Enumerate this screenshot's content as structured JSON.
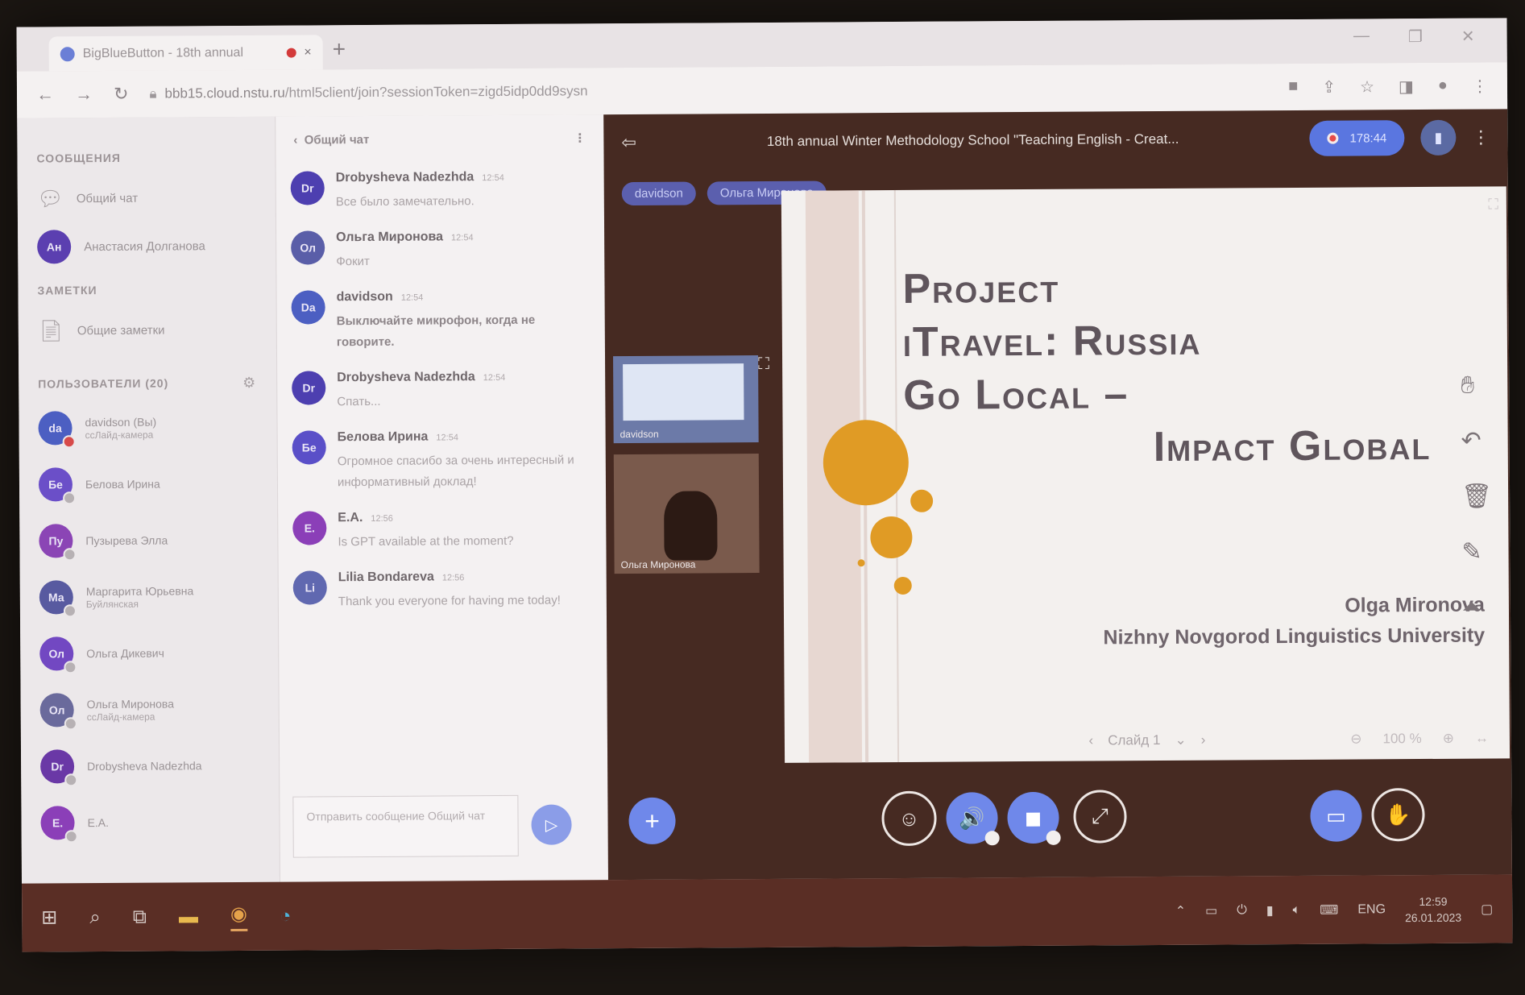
{
  "browser": {
    "tab_title": "BigBlueButton - 18th annual",
    "tab_close": "×",
    "new_tab": "+",
    "window_controls": [
      "—",
      "❐",
      "✕"
    ],
    "nav": {
      "back": "←",
      "forward": "→",
      "reload": "↻"
    },
    "url_host": "bbb15.cloud.nstu.ru",
    "url_path": "/html5client/join?sessionToken=zigd5idp0dd9sysn",
    "right_icons": [
      "camera-icon",
      "share-icon",
      "star-icon",
      "sidepanel-icon",
      "profile-icon",
      "menu-icon"
    ]
  },
  "sidebar": {
    "messages_title": "СООБЩЕНИЯ",
    "public_chat": "Общий чат",
    "private_chat_user": {
      "initials": "Ан",
      "name": "Анастасия Долганова",
      "color": "#5b3fb0"
    },
    "notes_title": "ЗАМЕТКИ",
    "shared_notes": "Общие заметки",
    "users_title": "ПОЛЬЗОВАТЕЛИ (20)",
    "users": [
      {
        "initials": "da",
        "name": "davidson (Вы)",
        "sub": "ссЛайд-камера",
        "color": "#4c5fc2",
        "mic": "red"
      },
      {
        "initials": "Бе",
        "name": "Белова Ирина",
        "sub": "",
        "color": "#6b4fc8",
        "mic": "grey"
      },
      {
        "initials": "Пу",
        "name": "Пузырева Элла",
        "sub": "",
        "color": "#8b45b5",
        "mic": "grey"
      },
      {
        "initials": "Ма",
        "name": "Маргарита Юрьевна",
        "sub": "Буйлянская",
        "color": "#585aa0",
        "mic": "grey"
      },
      {
        "initials": "Ол",
        "name": "Ольга Дикевич",
        "sub": "",
        "color": "#7248c2",
        "mic": "grey"
      },
      {
        "initials": "Ол",
        "name": "Ольга Миронова",
        "sub": "ссЛайд-камера",
        "color": "#6a6a9c",
        "mic": "grey"
      },
      {
        "initials": "Dr",
        "name": "Drobysheva Nadezhda",
        "sub": "",
        "color": "#6a38a6",
        "mic": "grey"
      },
      {
        "initials": "E.",
        "name": "E.A.",
        "sub": "",
        "color": "#8b3fb8",
        "mic": "grey"
      }
    ]
  },
  "chat": {
    "back_label": "Общий чат",
    "more": "⋮",
    "messages": [
      {
        "initials": "Dr",
        "color": "#4d3fb0",
        "name": "Drobysheva Nadezhda",
        "time": "12:54",
        "text": "Все было замечательно.",
        "bold": false
      },
      {
        "initials": "Ол",
        "color": "#5a5ea8",
        "name": "Ольга Миронова",
        "time": "12:54",
        "text": "Фокит",
        "bold": false
      },
      {
        "initials": "Da",
        "color": "#4c5fc2",
        "name": "davidson",
        "time": "12:54",
        "text": "Выключайте микрофон, когда не говорите.",
        "bold": true
      },
      {
        "initials": "Dr",
        "color": "#4d3fb0",
        "name": "Drobysheva Nadezhda",
        "time": "12:54",
        "text": "Спать...",
        "bold": false
      },
      {
        "initials": "Бе",
        "color": "#5a4fc8",
        "name": "Белова Ирина",
        "time": "12:54",
        "text": "Огромное спасибо за очень интересный и информативный доклад!",
        "bold": false
      },
      {
        "initials": "E.",
        "color": "#8b3fb8",
        "name": "E.A.",
        "time": "12:56",
        "text": "Is GPT available at the moment?",
        "bold": false
      },
      {
        "initials": "Li",
        "color": "#6068b0",
        "name": "Lilia Bondareva",
        "time": "12:56",
        "text": "Thank you everyone for having me today!",
        "bold": false
      }
    ],
    "input_placeholder": "Отправить сообщение Общий чат",
    "send": "▷"
  },
  "main": {
    "user_toggle": "⇦",
    "meeting_title": "18th annual Winter Methodology School \"Teaching English - Creat...",
    "recording_time": "178:44",
    "more": "⋮",
    "talking": [
      "davidson",
      "Ольга Миронова"
    ],
    "cams": [
      {
        "label": "davidson"
      },
      {
        "label": "Ольга Миронова"
      }
    ]
  },
  "slide": {
    "title_lines": [
      "Project",
      "iTravel: Russia",
      "Go Local –",
      "Impact Global"
    ],
    "author_name": "Olga Mironova",
    "author_org": "Nizhny Novgorod Linguistics University",
    "page_label": "Слайд 1",
    "zoom_label": "100 %",
    "tools": [
      "hand-icon",
      "undo-icon",
      "trash-icon",
      "pen-icon",
      "chart-icon"
    ],
    "accent_color": "#e09b25"
  },
  "actions": {
    "plus": "+",
    "react": "☺",
    "audio": "🔊",
    "video": "◼",
    "share": "⤢",
    "presentation": "▭",
    "hand": "✋"
  },
  "taskbar": {
    "start": "⊞",
    "search": "⌕",
    "lang": "ENG",
    "time": "12:59",
    "date": "26.01.2023"
  }
}
